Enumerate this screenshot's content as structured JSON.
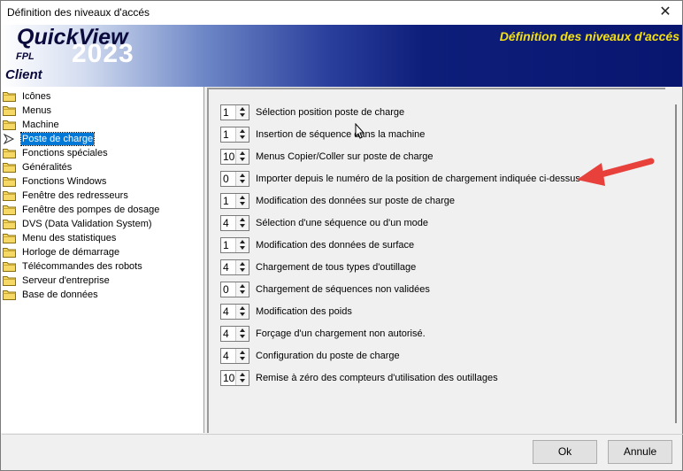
{
  "window": {
    "title": "Définition des niveaux d'accés"
  },
  "banner": {
    "logo": "QuickView",
    "year": "2023",
    "fpl": "FPL",
    "client": "Client",
    "heading": "Définition des niveaux d'accés"
  },
  "tree": {
    "items": [
      {
        "label": "Icônes"
      },
      {
        "label": "Menus"
      },
      {
        "label": "Machine"
      },
      {
        "label": "Poste de charge",
        "selected": true
      },
      {
        "label": "Fonctions spéciales"
      },
      {
        "label": "Généralités"
      },
      {
        "label": "Fonctions Windows"
      },
      {
        "label": "Fenêtre des redresseurs"
      },
      {
        "label": "Fenêtre des pompes de dosage"
      },
      {
        "label": "DVS (Data Validation System)"
      },
      {
        "label": "Menu des statistiques"
      },
      {
        "label": "Horloge de démarrage"
      },
      {
        "label": "Télécommandes des robots"
      },
      {
        "label": "Serveur d'entreprise"
      },
      {
        "label": "Base de données"
      }
    ]
  },
  "settings": [
    {
      "value": "1",
      "label": "Sélection position poste de charge"
    },
    {
      "value": "1",
      "label": "Insertion de séquence dans la machine"
    },
    {
      "value": "10",
      "label": "Menus Copier/Coller sur poste de charge"
    },
    {
      "value": "0",
      "label": "Importer depuis le numéro de la position de chargement indiquée ci-dessus"
    },
    {
      "value": "1",
      "label": "Modification des données sur poste de charge"
    },
    {
      "value": "4",
      "label": "Sélection d'une séquence ou d'un mode"
    },
    {
      "value": "1",
      "label": "Modification des données de surface"
    },
    {
      "value": "4",
      "label": "Chargement de tous types d'outillage"
    },
    {
      "value": "0",
      "label": "Chargement de séquences non validées"
    },
    {
      "value": "4",
      "label": "Modification des poids"
    },
    {
      "value": "4",
      "label": "Forçage d'un chargement non autorisé."
    },
    {
      "value": "4",
      "label": "Configuration du poste de charge"
    },
    {
      "value": "10",
      "label": "Remise à zéro des compteurs d'utilisation des outillages"
    }
  ],
  "buttons": {
    "ok": "Ok",
    "cancel": "Annule"
  },
  "colors": {
    "banner_heading": "#f5e10d",
    "selection": "#0078d7",
    "annotation_arrow": "#e8413c"
  },
  "icons": {
    "folder": "folder-icon",
    "selected_marker": "arrow-pointer-icon",
    "close": "close-icon"
  }
}
